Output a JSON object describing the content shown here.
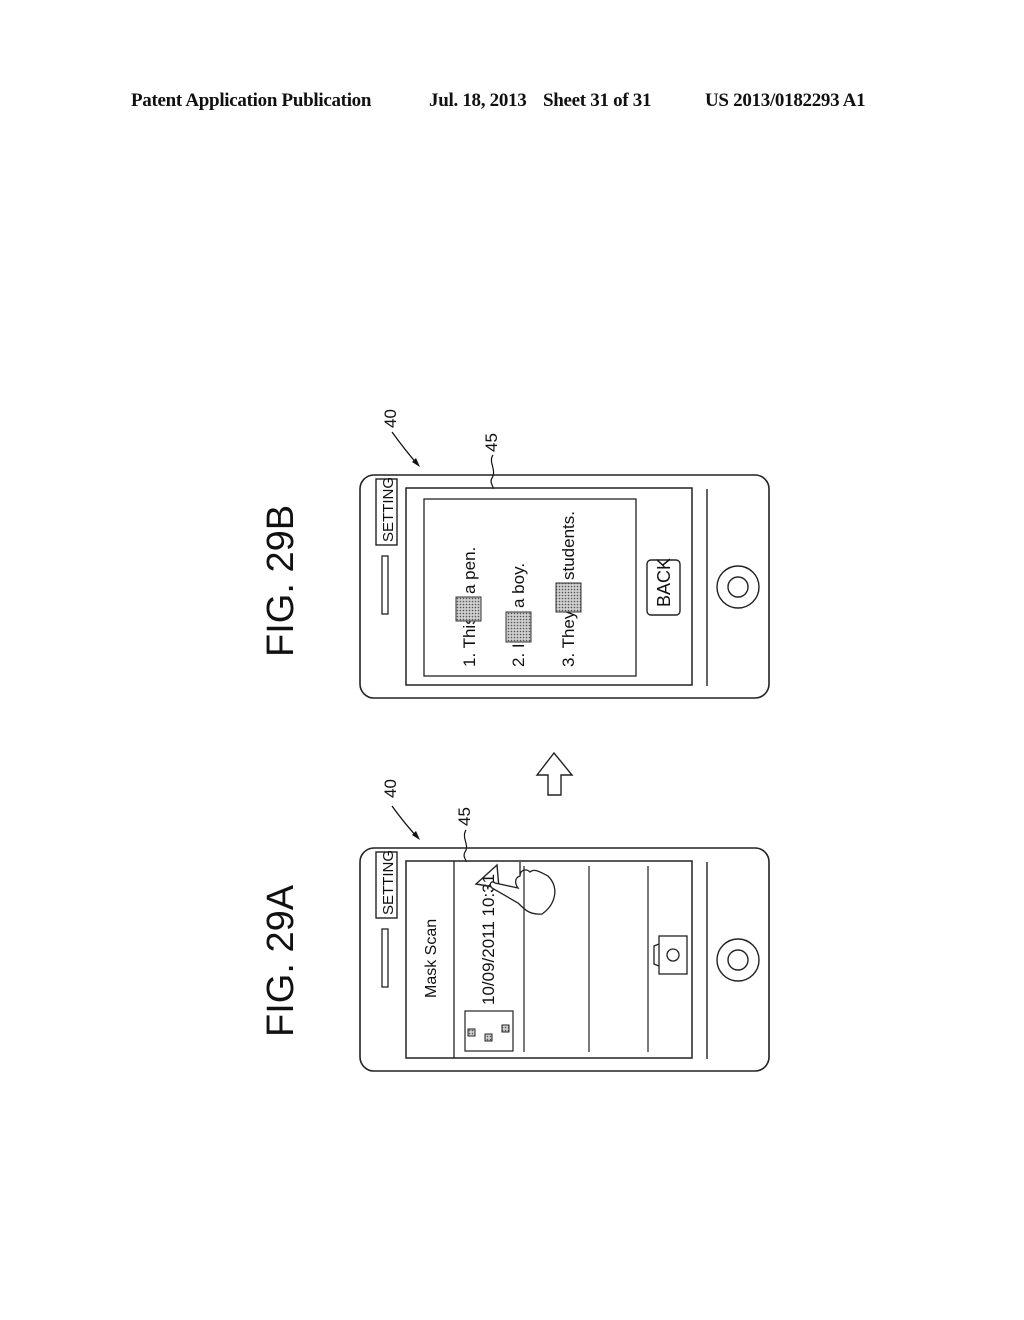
{
  "header": {
    "left": "Patent Application Publication",
    "date": "Jul. 18, 2013",
    "sheet": "Sheet 31 of 31",
    "number": "US 2013/0182293 A1"
  },
  "figures": {
    "fig_a": {
      "label": "FIG. 29A",
      "device_ref": "40",
      "screen_ref": "45",
      "setting_label": "SETTING",
      "app_title": "Mask Scan",
      "list_item_timestamp": "10/09/2011 10:31",
      "icons": [
        "play-triangle-icon",
        "hand-pointer-icon",
        "camera-icon",
        "home-button-icon",
        "thumbnail-icon"
      ]
    },
    "fig_b": {
      "label": "FIG. 29B",
      "device_ref": "40",
      "screen_ref": "45",
      "setting_label": "SETTING",
      "sentences": [
        {
          "before": "1. This",
          "after": "a  pen."
        },
        {
          "before": "2. I",
          "after": "a  boy."
        },
        {
          "before": "3. They",
          "after": "students."
        }
      ],
      "back_label": "BACK",
      "icons": [
        "home-button-icon"
      ]
    },
    "transition_arrow": "up-arrow-icon"
  }
}
